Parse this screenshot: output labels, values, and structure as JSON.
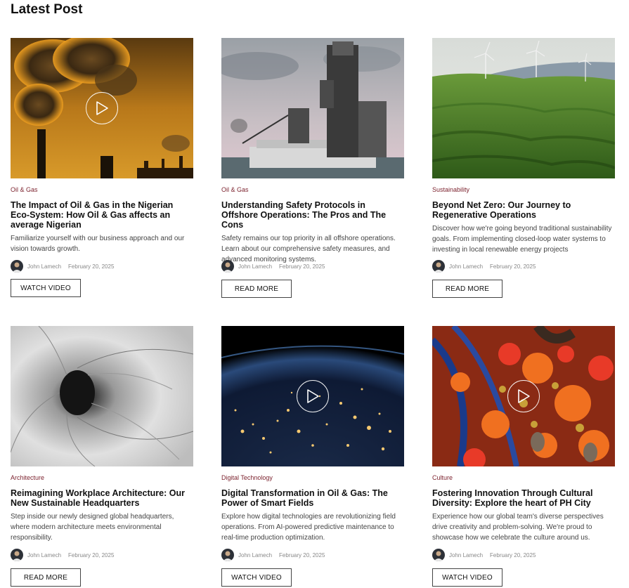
{
  "page": {
    "title": "Latest Post"
  },
  "posts": [
    {
      "category": "Oil & Gas",
      "title": "The Impact of Oil & Gas in the Nigerian Eco-System: How Oil & Gas affects an average Nigerian",
      "excerpt": "Familiarize yourself with our business approach and our vision towards growth.",
      "author": "John Lamech",
      "date": "February 20, 2025",
      "cta": "WATCH VIDEO",
      "image": "industrial-smoke-stacks",
      "has_play": true
    },
    {
      "category": "Oil & Gas",
      "title": "Understanding Safety Protocols in Offshore Operations: The Pros and The Cons",
      "excerpt": "Safety remains our top priority in all offshore operations. Learn about our comprehensive safety measures,  and advanced monitoring systems.",
      "author": "John Lamech",
      "date": "February 20, 2025",
      "cta": "READ MORE",
      "image": "offshore-drilling-rig",
      "has_play": false
    },
    {
      "category": "Sustainability",
      "title": "Beyond Net Zero: Our Journey to Regenerative Operations",
      "excerpt": "Discover how we're going beyond traditional sustainability goals. From implementing closed-loop water systems to investing in local renewable energy projects",
      "author": "John Lamech",
      "date": "February 20, 2025",
      "cta": "READ MORE",
      "image": "wind-turbines-green-hills",
      "has_play": false
    },
    {
      "category": "Architecture",
      "title": "Reimagining Workplace Architecture: Our New Sustainable Headquarters",
      "excerpt": "Step inside our newly designed global headquarters, where modern architecture meets environmental responsibility.",
      "author": "John Lamech",
      "date": "February 20, 2025",
      "cta": "READ MORE",
      "image": "spiral-architecture-bw",
      "has_play": false
    },
    {
      "category": "Digital Technology",
      "title": "Digital Transformation in Oil & Gas: The Power of Smart Fields",
      "excerpt": "Explore how digital technologies are revolutionizing field operations. From AI-powered predictive maintenance to real-time production optimization.",
      "author": "John Lamech",
      "date": "February 20, 2025",
      "cta": "WATCH VIDEO",
      "image": "earth-at-night-from-space",
      "has_play": true
    },
    {
      "category": "Culture",
      "title": "Fostering Innovation Through Cultural Diversity: Explore the heart of PH City",
      "excerpt": "Experience how our global team's diverse perspectives drive creativity and problem-solving. We're proud to showcase how we celebrate the culture around us.",
      "author": "John Lamech",
      "date": "February 20, 2025",
      "cta": "WATCH VIDEO",
      "image": "colorful-cultural-beads",
      "has_play": true
    }
  ]
}
